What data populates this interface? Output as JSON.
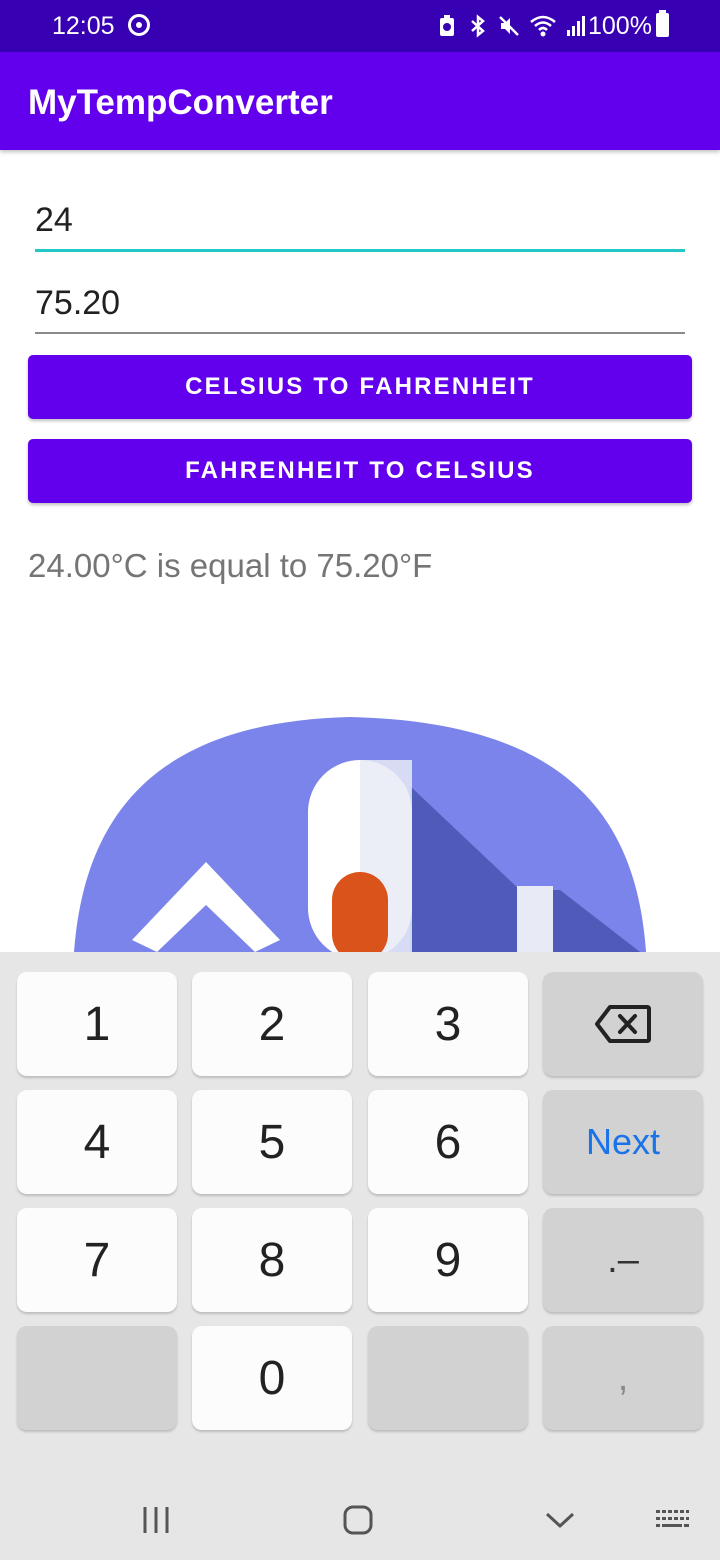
{
  "status_bar": {
    "time": "12:05",
    "battery": "100%",
    "icons": [
      "sync-icon",
      "battery-saver-icon",
      "bluetooth-icon",
      "mute-icon",
      "wifi-icon",
      "signal-icon",
      "battery-icon"
    ]
  },
  "app_bar": {
    "title": "MyTempConverter"
  },
  "form": {
    "celsius_value": "24",
    "fahrenheit_value": "75.20",
    "celsius_to_fahrenheit_label": "CELSIUS TO FAHRENHEIT",
    "fahrenheit_to_celsius_label": "FAHRENHEIT TO CELSIUS",
    "result": "24.00°C is equal to 75.20°F"
  },
  "keyboard": {
    "keys": [
      "1",
      "2",
      "3",
      "4",
      "5",
      "6",
      "Next",
      "7",
      "8",
      "9",
      ".–",
      "0",
      ","
    ]
  },
  "colors": {
    "primary": "#6200ee",
    "primary_dark": "#3700b3",
    "focus_underline": "#22c7c7",
    "next_key": "#1a73e8"
  }
}
